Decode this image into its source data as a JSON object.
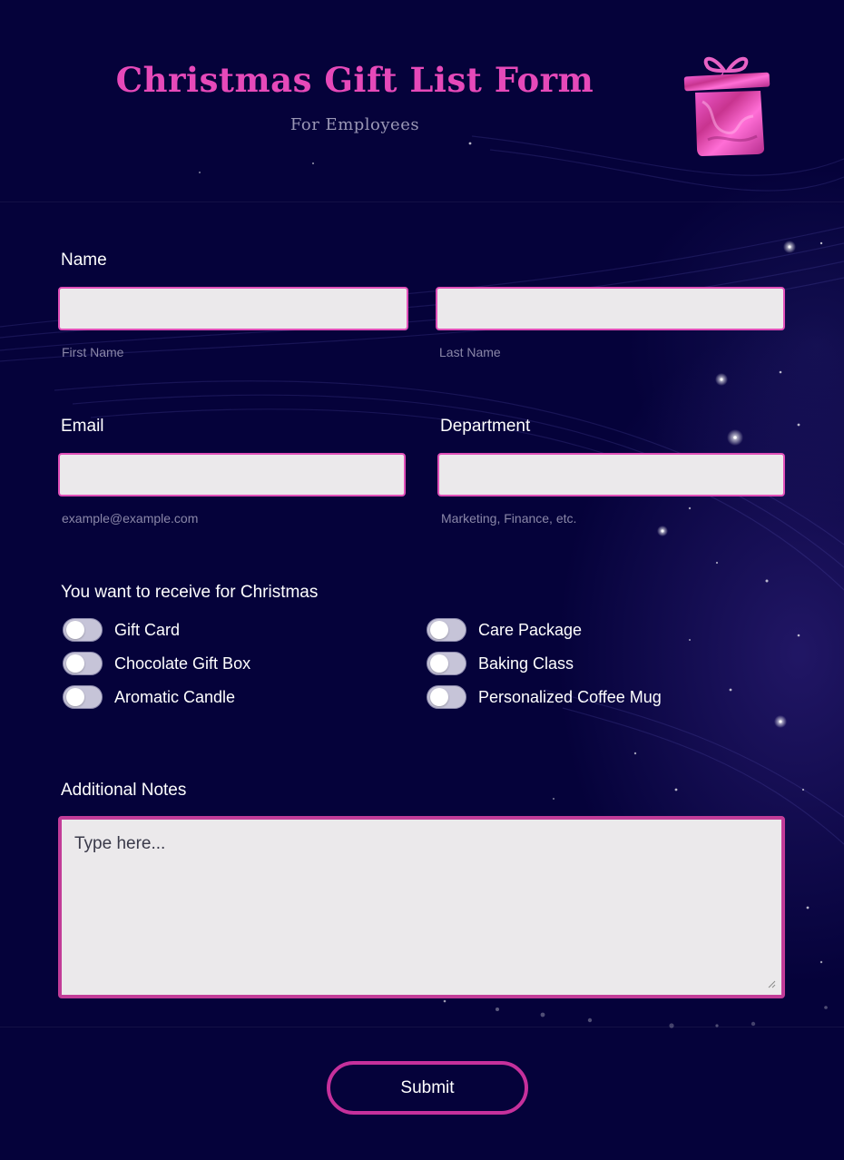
{
  "header": {
    "title": "Christmas Gift List Form",
    "subtitle": "For Employees",
    "icon": "gift-box-icon"
  },
  "name": {
    "label": "Name",
    "first_hint": "First Name",
    "last_hint": "Last Name",
    "first_value": "",
    "last_value": ""
  },
  "email": {
    "label": "Email",
    "hint": "example@example.com",
    "value": ""
  },
  "department": {
    "label": "Department",
    "hint": "Marketing, Finance, etc.",
    "value": ""
  },
  "gifts": {
    "label": "You want to receive for Christmas",
    "options": [
      {
        "label": "Gift Card",
        "checked": false
      },
      {
        "label": "Chocolate Gift Box",
        "checked": false
      },
      {
        "label": "Aromatic Candle",
        "checked": false
      },
      {
        "label": "Care Package",
        "checked": false
      },
      {
        "label": "Baking Class",
        "checked": false
      },
      {
        "label": "Personalized Coffee Mug",
        "checked": false
      }
    ]
  },
  "notes": {
    "label": "Additional Notes",
    "placeholder": "Type here...",
    "value": ""
  },
  "submit": {
    "label": "Submit"
  },
  "colors": {
    "background": "#05023a",
    "accent_pink": "#e649b9",
    "input_fill": "#ebe9eb",
    "toggle_off": "#c6c4d8"
  }
}
